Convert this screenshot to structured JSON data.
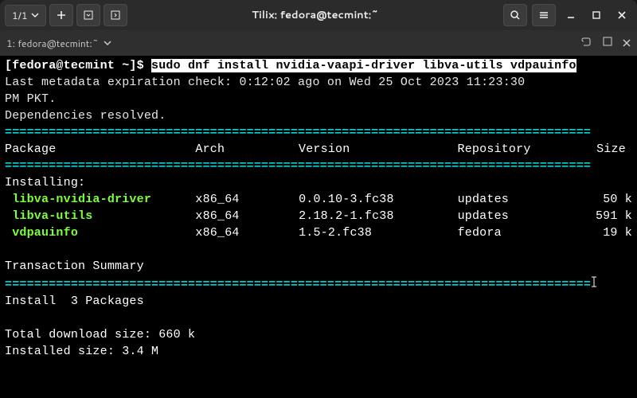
{
  "window": {
    "title": "Tilix: fedora@tecmint:~",
    "page_counter": "1/1"
  },
  "tab": {
    "label": "1: fedora@tecmint:~"
  },
  "terminal": {
    "prompt": "[fedora@tecmint ~]$ ",
    "command": "sudo dnf install nvidia-vaapi-driver libva-utils vdpauinfo",
    "metadata_line1": "Last metadata expiration check: 0:12:02 ago on Wed 25 Oct 2023 11:23:30",
    "metadata_line2": "PM PKT.",
    "deps_resolved": "Dependencies resolved.",
    "divider": "================================================================================",
    "headers": {
      "package": "Package",
      "arch": "Arch",
      "version": "Version",
      "repo": "Repository",
      "size": "Size"
    },
    "installing_label": "Installing:",
    "packages": [
      {
        "name": "libva-nvidia-driver",
        "arch": "x86_64",
        "version": "0.0.10-3.fc38",
        "repo": "updates",
        "size": "50 k"
      },
      {
        "name": "libva-utils",
        "arch": "x86_64",
        "version": "2.18.2-1.fc38",
        "repo": "updates",
        "size": "591 k"
      },
      {
        "name": "vdpauinfo",
        "arch": "x86_64",
        "version": "1.5-2.fc38",
        "repo": "fedora",
        "size": "19 k"
      }
    ],
    "transaction_summary": "Transaction Summary",
    "install_count": "Install  3 Packages",
    "download_size": "Total download size: 660 k",
    "installed_size": "Installed size: 3.4 M"
  }
}
